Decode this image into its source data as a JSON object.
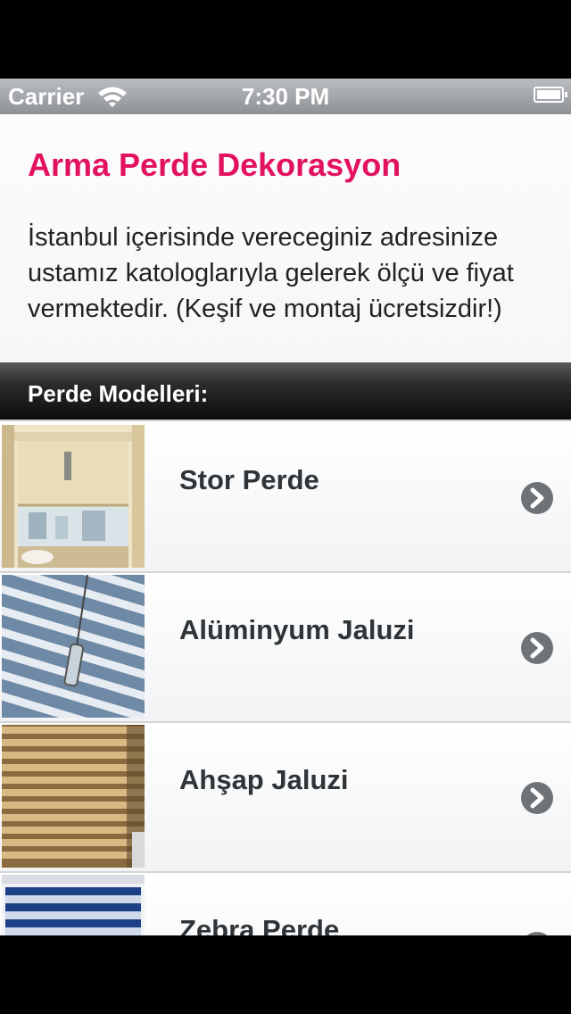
{
  "status_bar": {
    "carrier": "Carrier",
    "time": "7:30 PM"
  },
  "header": {
    "title": "Arma Perde Dekorasyon",
    "description": "İstanbul içerisinde vereceginiz adresinize ustamız katologlarıyla gelerek ölçü ve fiyat vermektedir. (Keşif ve montaj ücretsizdir!)"
  },
  "section": {
    "title": "Perde Modelleri:"
  },
  "items": [
    {
      "label": "Stor Perde",
      "icon": "chevron-right-icon"
    },
    {
      "label": "Alüminyum Jaluzi",
      "icon": "chevron-right-icon"
    },
    {
      "label": "Ahşap Jaluzi",
      "icon": "chevron-right-icon"
    },
    {
      "label": "Zebra Perde",
      "icon": "chevron-right-icon"
    }
  ],
  "colors": {
    "title": "#e2125f",
    "section_bg": "#1a1a1a"
  }
}
